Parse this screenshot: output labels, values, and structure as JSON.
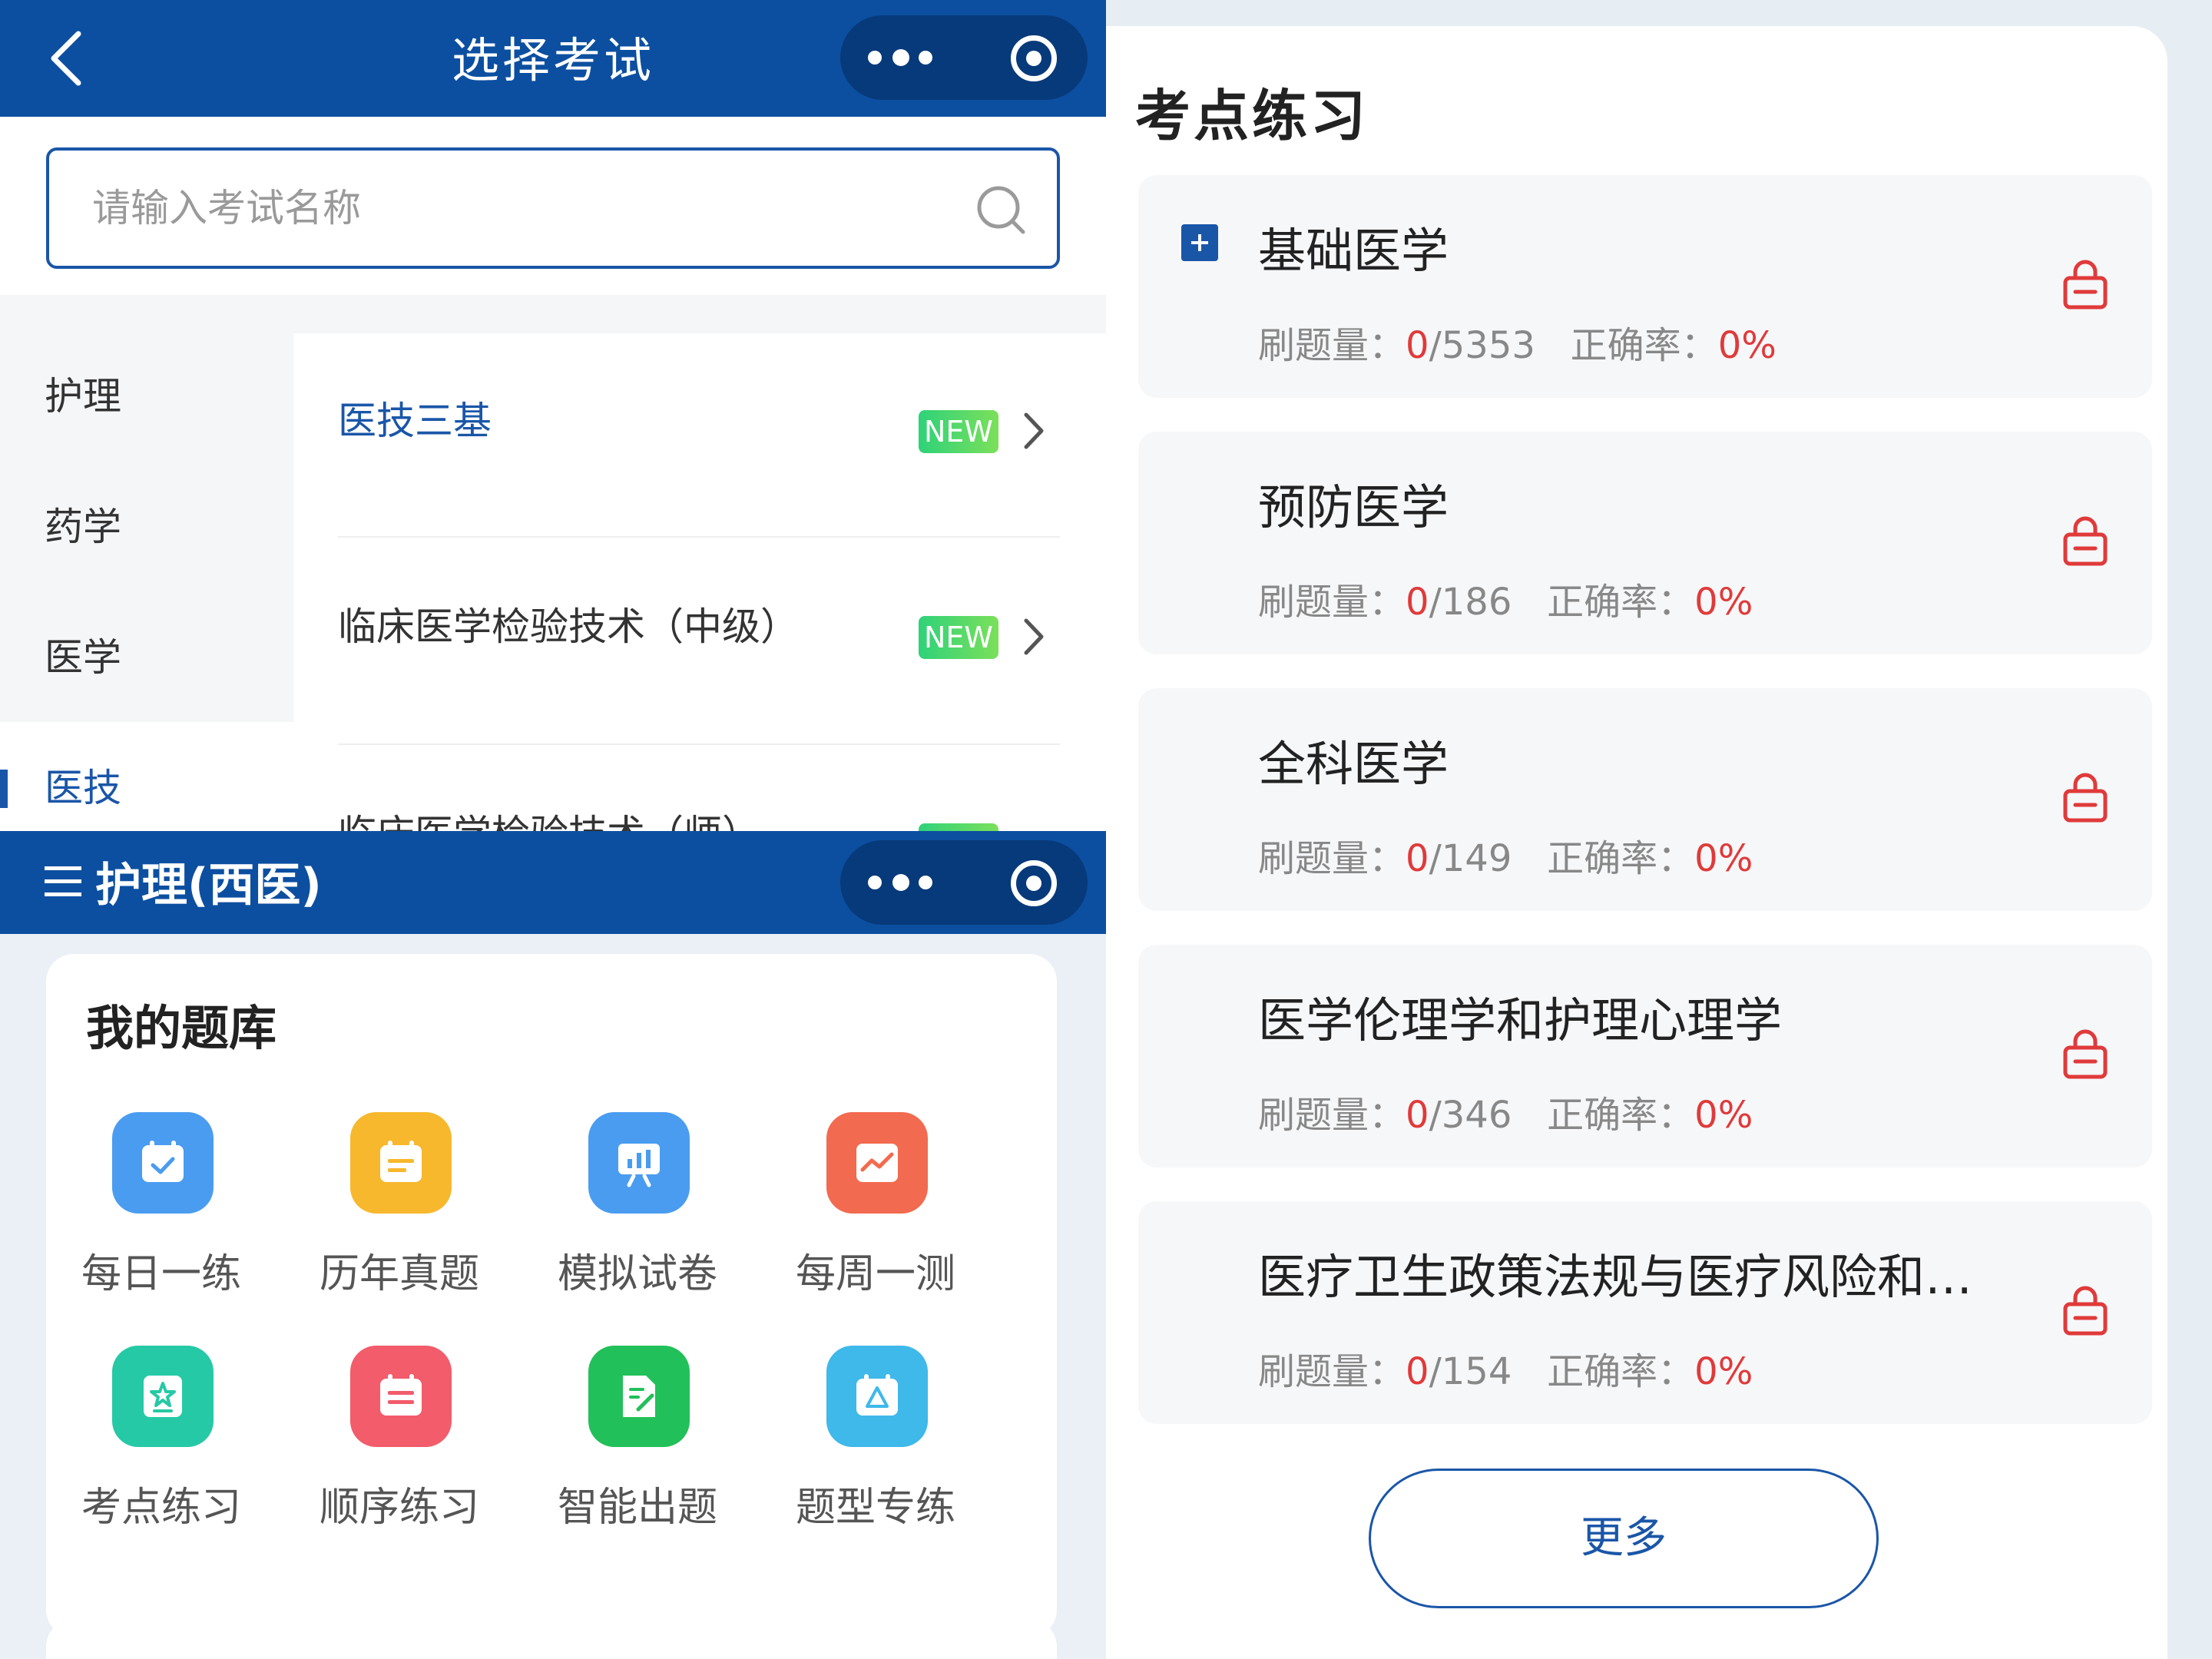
{
  "exam_select": {
    "title": "选择考试",
    "search_placeholder": "请输入考试名称",
    "categories": [
      {
        "label": "护理",
        "active": false
      },
      {
        "label": "药学",
        "active": false
      },
      {
        "label": "医学",
        "active": false
      },
      {
        "label": "医技",
        "active": true
      }
    ],
    "exams": [
      {
        "name": "医技三基",
        "badge": "NEW",
        "active": true
      },
      {
        "name": "临床医学检验技术（中级）",
        "badge": "NEW",
        "active": false
      },
      {
        "name": "临床医学检验技术（师）",
        "badge": "NEW",
        "active": false
      }
    ]
  },
  "question_bank": {
    "nav_title": "护理(西医)",
    "section_title": "我的题库",
    "items": [
      {
        "label": "每日一练",
        "icon": "calendar-check-icon",
        "color": "#4a9cf0"
      },
      {
        "label": "历年真题",
        "icon": "calendar-list-icon",
        "color": "#f7b82e"
      },
      {
        "label": "模拟试卷",
        "icon": "presentation-chart-icon",
        "color": "#4a9cf0"
      },
      {
        "label": "每周一测",
        "icon": "line-chart-icon",
        "color": "#f26a4f"
      },
      {
        "label": "考点练习",
        "icon": "star-badge-icon",
        "color": "#26c9a5"
      },
      {
        "label": "顺序练习",
        "icon": "calendar-list-icon",
        "color": "#f25c6b"
      },
      {
        "label": "智能出题",
        "icon": "document-edit-icon",
        "color": "#22c05a"
      },
      {
        "label": "题型专练",
        "icon": "triangle-calendar-icon",
        "color": "#3fb8ea"
      }
    ]
  },
  "practice": {
    "title": "考点练习",
    "count_label": "刷题量：",
    "accuracy_label": "正确率：",
    "subjects": [
      {
        "name": "基础医学",
        "done": "0",
        "total": "/5353",
        "accuracy": "0%",
        "expanded_icon": true
      },
      {
        "name": "预防医学",
        "done": "0",
        "total": "/186",
        "accuracy": "0%",
        "expanded_icon": false
      },
      {
        "name": "全科医学",
        "done": "0",
        "total": "/149",
        "accuracy": "0%",
        "expanded_icon": false
      },
      {
        "name": "医学伦理学和护理心理学",
        "done": "0",
        "total": "/346",
        "accuracy": "0%",
        "expanded_icon": false
      },
      {
        "name": "医疗卫生政策法规与医疗风险和…",
        "done": "0",
        "total": "/154",
        "accuracy": "0%",
        "expanded_icon": false
      }
    ],
    "more_label": "更多"
  },
  "colors": {
    "brand_blue": "#0c4fa0",
    "accent_red": "#e03a3a",
    "new_badge_green": "#2fd27a"
  }
}
